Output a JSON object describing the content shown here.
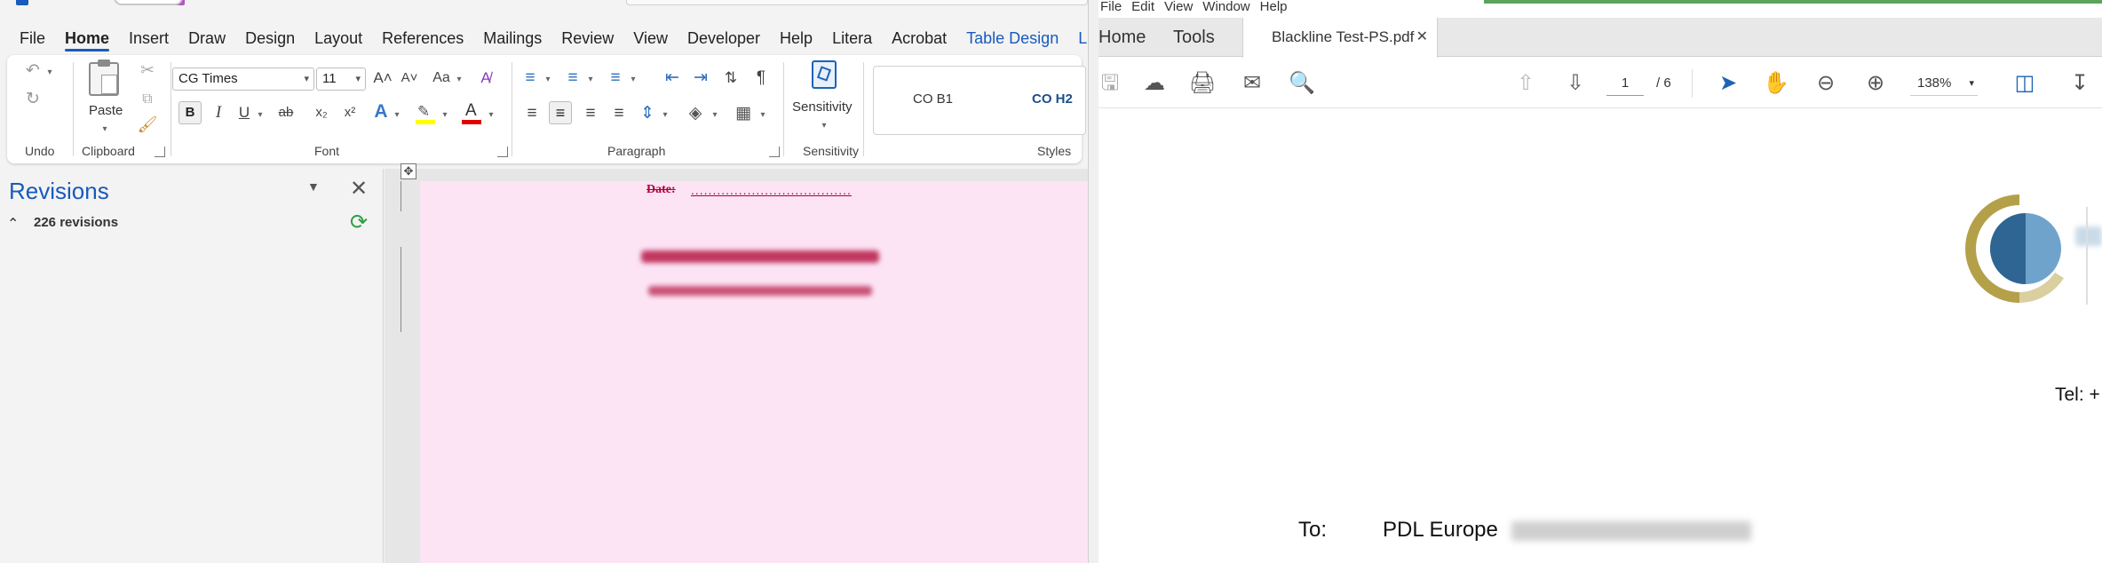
{
  "word": {
    "menu": [
      "File",
      "Home",
      "Insert",
      "Draw",
      "Design",
      "Layout",
      "References",
      "Mailings",
      "Review",
      "View",
      "Developer",
      "Help",
      "Litera",
      "Acrobat",
      "Table Design",
      "Layou"
    ],
    "active_tab": "Home",
    "ribbon": {
      "undo_label": "Undo",
      "clipboard_label": "Clipboard",
      "paste_label": "Paste",
      "font_label": "Font",
      "font_name": "CG Times",
      "font_size": "11",
      "paragraph_label": "Paragraph",
      "sensitivity_label": "Sensitivity",
      "sensitivity_button": "Sensitivity",
      "styles_label": "Styles",
      "style_1": "CO B1",
      "style_2": "CO H2",
      "bold": "B",
      "italic": "I",
      "underline": "U",
      "strike": "ab",
      "subscript": "x₂",
      "superscript": "x²",
      "change_case": "Aa",
      "grow": "A˄",
      "shrink": "A˅"
    },
    "revisions": {
      "title": "Revisions",
      "count": "226 revisions"
    },
    "document": {
      "date_label": "Date:",
      "date_dots": "....................................."
    },
    "colors": {
      "accent": "#185abd",
      "revision_pink": "#fce4f5",
      "revision_text": "#b0003a"
    }
  },
  "acrobat": {
    "menu": [
      "File",
      "Edit",
      "View",
      "Window",
      "Help"
    ],
    "tabs": {
      "home": "Home",
      "tools": "Tools",
      "document": "Blackline Test-PS.pdf"
    },
    "page_current": "1",
    "page_total": "/ 6",
    "zoom": "138%",
    "page": {
      "tel": "Tel: +",
      "to_label": "To:",
      "to_value": "PDL Europe"
    },
    "colors": {
      "logo_dark": "#2f6592",
      "logo_light": "#6fa3cc",
      "logo_gold": "#b5a04a",
      "logo_gold_light": "#d9cf9f",
      "select_blue": "#1e63b5"
    }
  }
}
